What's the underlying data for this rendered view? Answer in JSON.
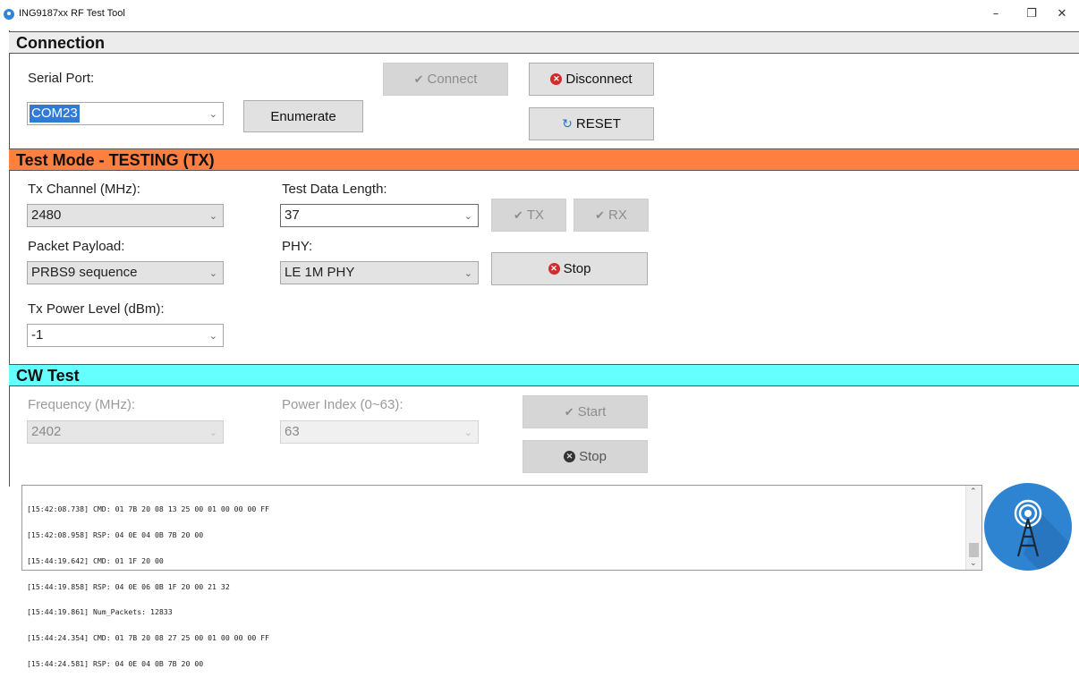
{
  "window": {
    "title": "ING9187xx RF Test Tool",
    "minimize": "–",
    "restore": "❐",
    "close": "✕"
  },
  "connection": {
    "header": "Connection",
    "serial_port_label": "Serial Port:",
    "serial_port_value": "COM23",
    "enumerate_label": "Enumerate",
    "connect_label": "Connect",
    "disconnect_label": "Disconnect",
    "reset_label": "RESET"
  },
  "test_mode": {
    "header": "Test Mode - TESTING (TX)",
    "tx_channel_label": "Tx Channel (MHz):",
    "tx_channel_value": "2480",
    "test_data_length_label": "Test Data Length:",
    "test_data_length_value": "37",
    "tx_label": "TX",
    "rx_label": "RX",
    "packet_payload_label": "Packet Payload:",
    "packet_payload_value": "PRBS9 sequence",
    "phy_label": "PHY:",
    "phy_value": "LE 1M PHY",
    "stop_label": "Stop",
    "tx_power_label": "Tx Power Level (dBm):",
    "tx_power_value": "-1"
  },
  "cw_test": {
    "header": "CW Test",
    "frequency_label": "Frequency (MHz):",
    "frequency_value": "2402",
    "power_index_label": "Power Index (0~63):",
    "power_index_value": "63",
    "start_label": "Start",
    "stop_label": "Stop"
  },
  "log": {
    "lines": [
      "[15:42:08.738] CMD: 01 7B 20 08 13 25 00 01 00 00 00 FF",
      "[15:42:08.958] RSP: 04 0E 04 0B 7B 20 00",
      "[15:44:19.642] CMD: 01 1F 20 00",
      "[15:44:19.858] RSP: 04 0E 06 0B 1F 20 00 21 32",
      "[15:44:19.861] Num_Packets: 12833",
      "[15:44:24.354] CMD: 01 7B 20 08 27 25 00 01 00 00 00 FF",
      "[15:44:24.581] RSP: 04 0E 04 0B 7B 20 00"
    ]
  },
  "colors": {
    "test_mode_header": "#ff7f3f",
    "cw_header": "#66ffff",
    "connection_header": "#ececec"
  },
  "icons": {
    "app": "app-logo-icon",
    "connect": "checkmark-icon",
    "disconnect": "x-circle-icon",
    "reset": "refresh-icon",
    "logo": "radio-tower-icon"
  }
}
